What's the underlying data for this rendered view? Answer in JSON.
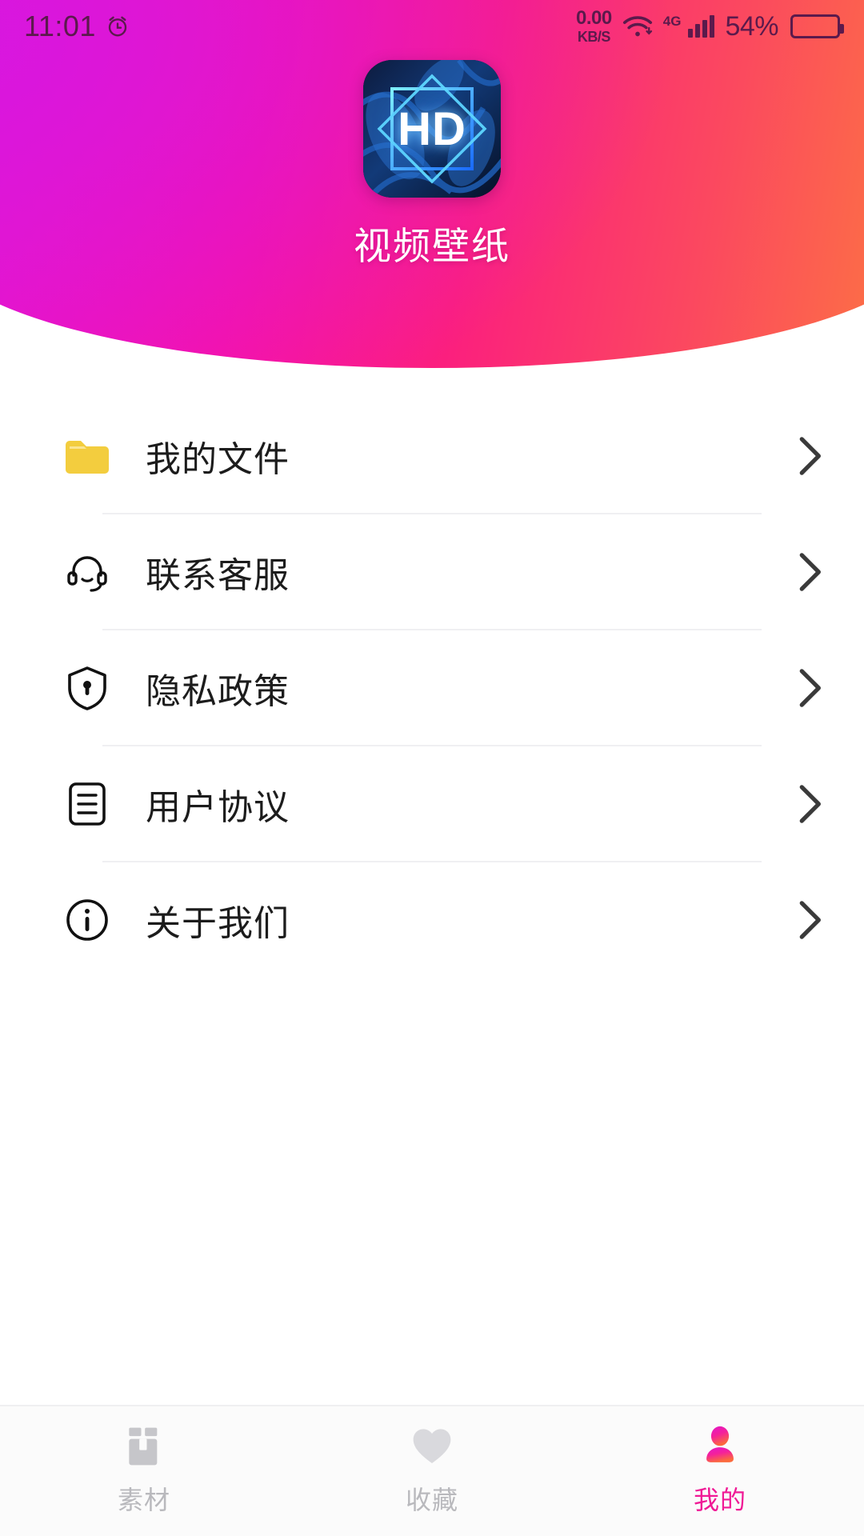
{
  "status_bar": {
    "time": "11:01",
    "alarm_icon": "alarm-clock-icon",
    "net_speed_value": "0.00",
    "net_speed_unit": "KB/S",
    "wifi_icon": "wifi-icon",
    "network_type": "4G",
    "signal_icon": "cellular-signal-icon",
    "battery_percent": "54%",
    "battery_icon": "battery-icon",
    "text_color": "#5b1a4c"
  },
  "header": {
    "app_name": "视频壁纸",
    "logo_text": "HD",
    "logo_icon": "app-logo-hd-icon",
    "gradient_start": "#e315d8",
    "gradient_mid": "#fb1f7e",
    "gradient_end": "#fd7a3e"
  },
  "menu": {
    "items": [
      {
        "label": "我的文件",
        "icon": "folder-icon",
        "chevron": "chevron-right-icon",
        "icon_color": "#f5cd3f"
      },
      {
        "label": "联系客服",
        "icon": "headset-icon",
        "chevron": "chevron-right-icon",
        "icon_color": "#1c1c1c"
      },
      {
        "label": "隐私政策",
        "icon": "shield-lock-icon",
        "chevron": "chevron-right-icon",
        "icon_color": "#1c1c1c"
      },
      {
        "label": "用户协议",
        "icon": "document-lines-icon",
        "chevron": "chevron-right-icon",
        "icon_color": "#1c1c1c"
      },
      {
        "label": "关于我们",
        "icon": "info-circle-icon",
        "chevron": "chevron-right-icon",
        "icon_color": "#1c1c1c"
      }
    ]
  },
  "tabbar": {
    "active_color": "#f01a96",
    "inactive_color": "#b9b9bd",
    "tabs": [
      {
        "label": "素材",
        "icon": "materials-box-icon",
        "active": false
      },
      {
        "label": "收藏",
        "icon": "heart-icon",
        "active": false
      },
      {
        "label": "我的",
        "icon": "person-icon",
        "active": true
      }
    ]
  }
}
